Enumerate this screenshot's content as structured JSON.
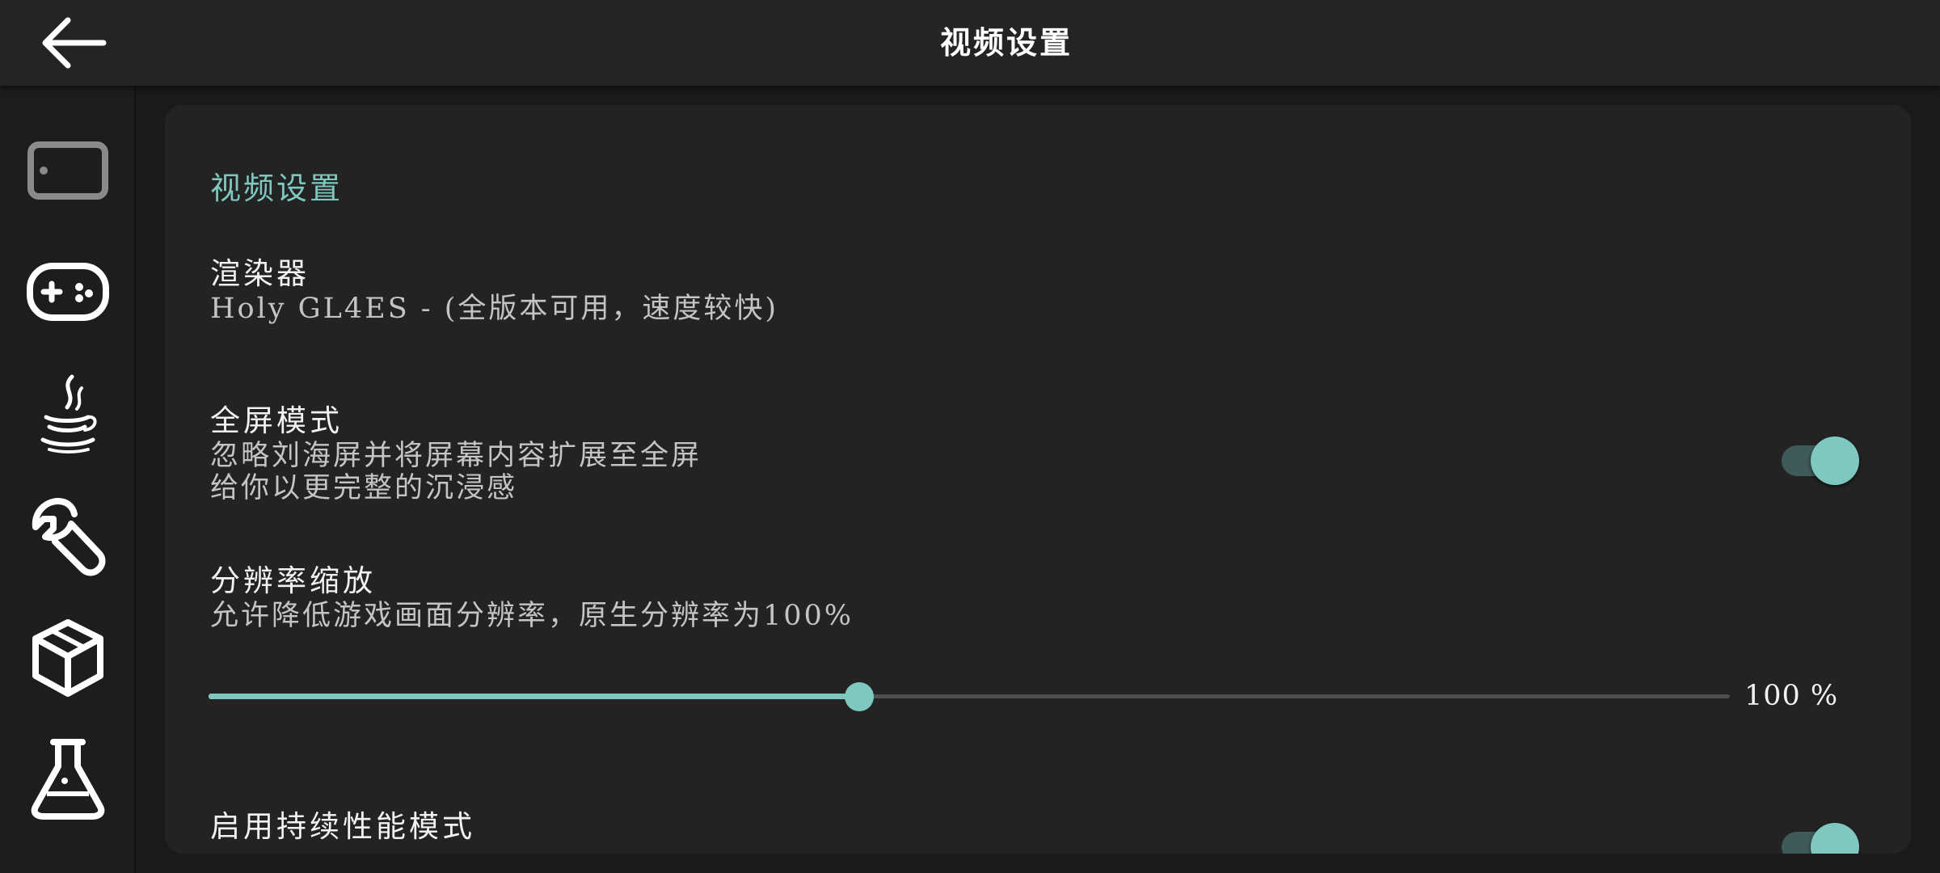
{
  "topbar": {
    "title": "视频设置"
  },
  "icons": {
    "back": "arrow-left-icon",
    "sidebar": [
      "tablet-icon",
      "gamepad-icon",
      "java-icon",
      "wrench-icon",
      "package-icon",
      "flask-icon"
    ]
  },
  "colors": {
    "accent": "#7fc8c0",
    "switch_track_on": "#3f5a58",
    "background": "#1a1a1a",
    "card": "#232323"
  },
  "section": {
    "header": "视频设置"
  },
  "renderer": {
    "title": "渲染器",
    "summary": "Holy GL4ES - (全版本可用，速度较快)"
  },
  "fullscreen": {
    "title": "全屏模式",
    "summary_line1": "忽略刘海屏并将屏幕内容扩展至全屏",
    "summary_line2": "给你以更完整的沉浸感",
    "enabled": true
  },
  "resolution": {
    "title": "分辨率缩放",
    "summary": "允许降低游戏画面分辨率，原生分辨率为100%",
    "slider_fraction": 0.428,
    "value_label": "100 %"
  },
  "sustained": {
    "title": "启用持续性能模式",
    "enabled": true
  }
}
